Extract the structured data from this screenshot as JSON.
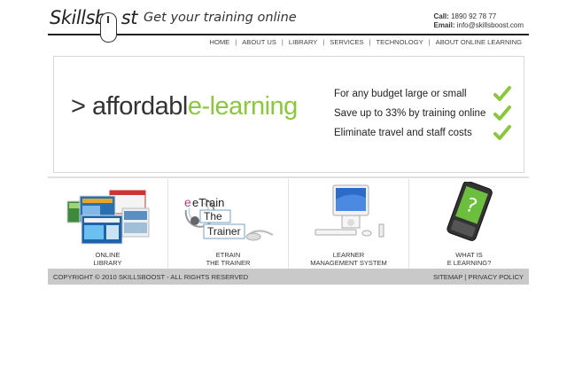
{
  "header": {
    "logo_text": "Skillsb",
    "logo_text_end": "st",
    "tagline": "Get your training online",
    "call_label": "Call:",
    "call_value": "1890 92 78 77",
    "email_label": "Email:",
    "email_value": "info@skillsboost.com"
  },
  "nav": {
    "items": [
      {
        "label": "HOME"
      },
      {
        "label": "ABOUT US"
      },
      {
        "label": "LIBRARY"
      },
      {
        "label": "SERVICES"
      },
      {
        "label": "TECHNOLOGY"
      },
      {
        "label": "ABOUT ONLINE LEARNING"
      }
    ],
    "separator": "|"
  },
  "hero": {
    "prefix": "> affordabl",
    "highlight": "e-learning",
    "benefits": [
      "For any budget large or small",
      "Save up to 33% by training online",
      "Eliminate travel and staff costs"
    ],
    "check_color": "#8cc63f"
  },
  "boxes": [
    {
      "line1": "ONLINE",
      "line2": "LIBRARY"
    },
    {
      "line1": "eTRAIN",
      "line2": "THE TRAINER",
      "art_lines": [
        "eTrain",
        "The",
        "Trainer"
      ]
    },
    {
      "line1": "LEARNER",
      "line2": "MANAGEMENT SYSTEM"
    },
    {
      "line1": "WHAT IS",
      "line2": "E LEARNING?"
    }
  ],
  "footer": {
    "copyright": "COPYRIGHT © 2010 SKILLSBOOST - ALL RIGHTS RESERVED",
    "sitemap": "SITEMAP",
    "privacy": "PRIVACY POLICY",
    "separator": "|"
  }
}
